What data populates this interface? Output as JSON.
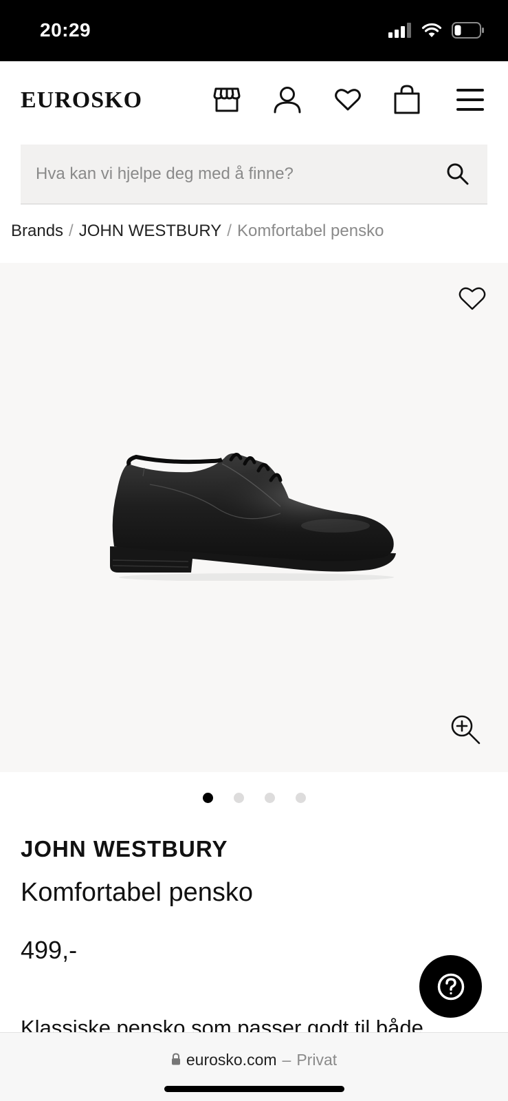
{
  "status_bar": {
    "time": "20:29",
    "icons": [
      "cellular-signal-icon",
      "wifi-icon",
      "battery-icon"
    ]
  },
  "header": {
    "logo": "EUROSKO",
    "icons": [
      "store-icon",
      "account-icon",
      "wishlist-heart-icon",
      "shopping-bag-icon",
      "menu-icon"
    ]
  },
  "search": {
    "placeholder": "Hva kan vi hjelpe deg med å finne?",
    "value": ""
  },
  "breadcrumb": {
    "items": [
      "Brands",
      "JOHN WESTBURY"
    ],
    "separator": "/",
    "current": "Komfortabel pensko"
  },
  "gallery": {
    "image_count": 4,
    "active_index": 0
  },
  "product": {
    "brand": "JOHN WESTBURY",
    "title": "Komfortabel pensko",
    "price": "499,-",
    "description_start": "Klassiske pensko som passer godt til både"
  },
  "browser": {
    "url": "eurosko.com",
    "separator": "–",
    "mode": "Privat"
  },
  "colors": {
    "status_bar": "#000000",
    "gallery_bg": "#f8f7f6",
    "search_bg": "#f2f1f0",
    "accent": "#000000"
  }
}
